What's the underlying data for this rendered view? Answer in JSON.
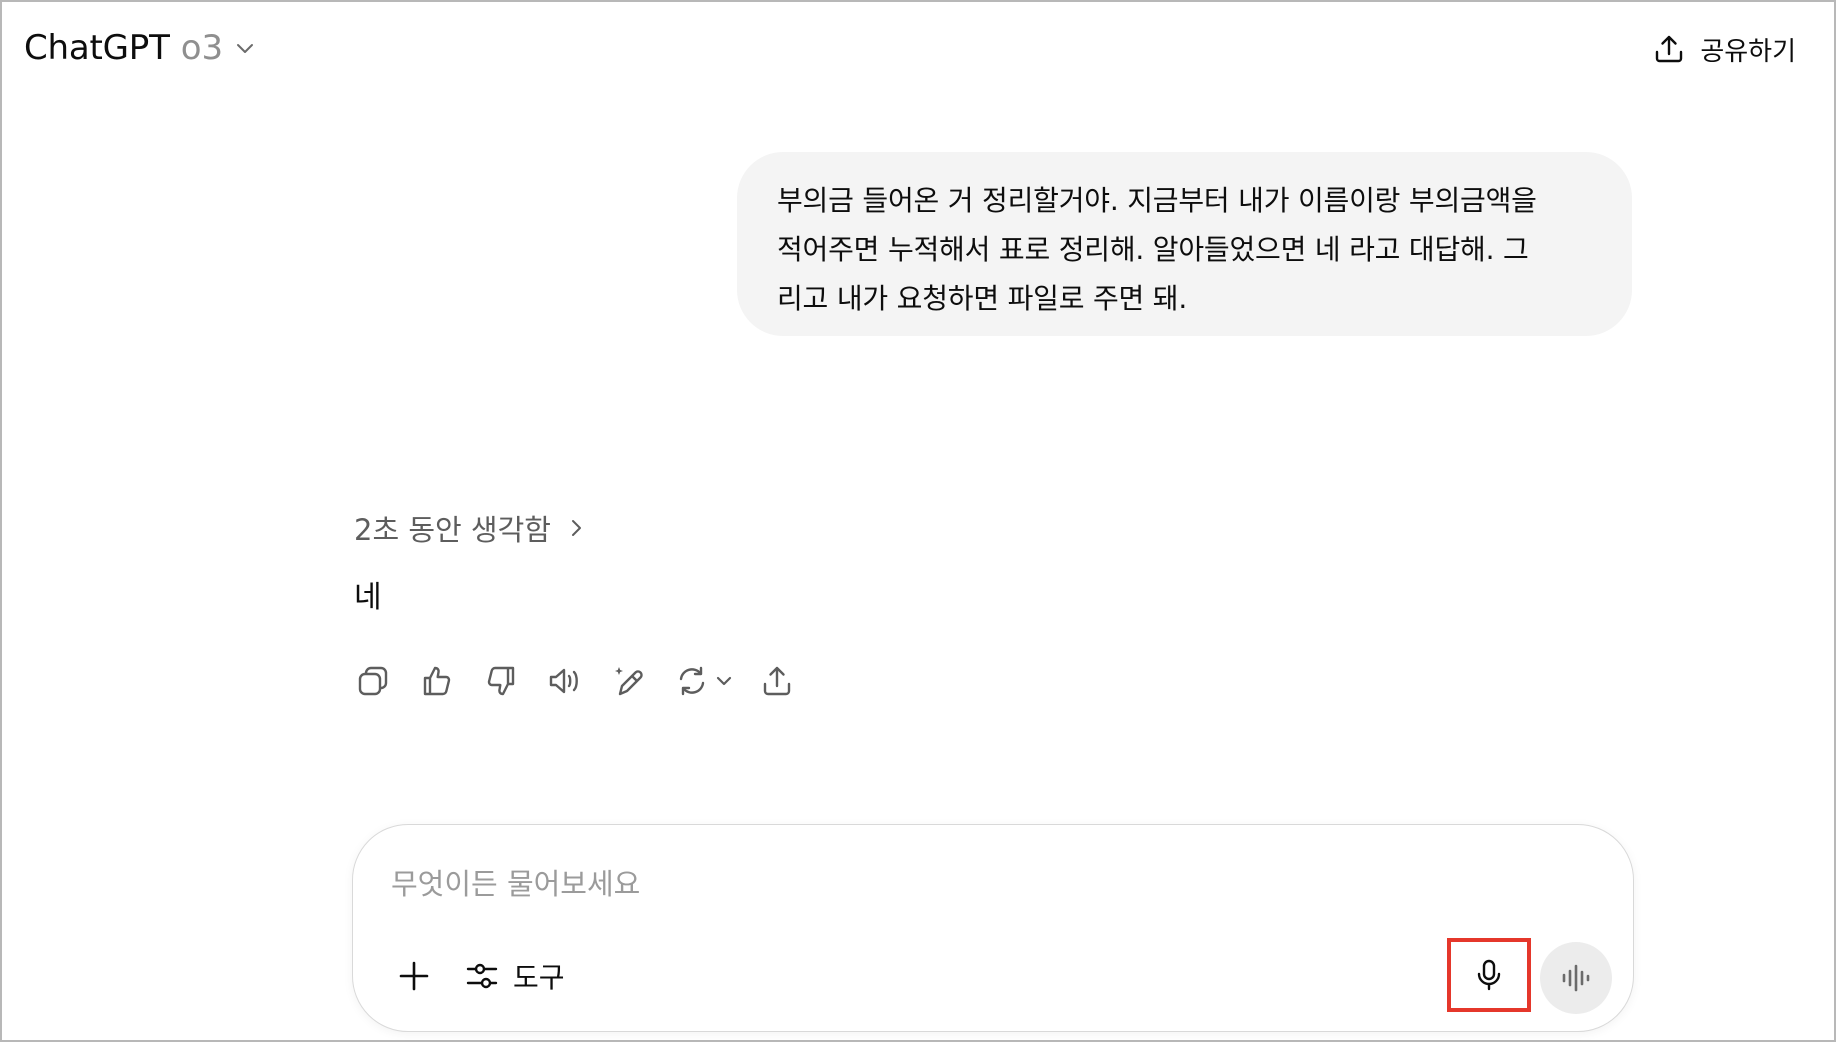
{
  "header": {
    "brand": "ChatGPT",
    "model": "o3",
    "share_label": "공유하기"
  },
  "conversation": {
    "user_message_lines": [
      "부의금 들어온 거 정리할거야. 지금부터 내가 이름이랑 부의금액을",
      "적어주면 누적해서 표로 정리해. 알아들었으면 네 라고 대답해. 그",
      "리고 내가 요청하면 파일로 주면 돼."
    ],
    "thought_label": "2초 동안 생각함",
    "assistant_reply": "네",
    "action_icons": [
      "copy-icon",
      "thumbs-up-icon",
      "thumbs-down-icon",
      "read-aloud-icon",
      "edit-canvas-icon",
      "regenerate-icon",
      "share-icon"
    ]
  },
  "composer": {
    "placeholder": "무엇이든 물어보세요",
    "value": "",
    "tools_label": "도구"
  },
  "colors": {
    "highlight_box": "#e5372b",
    "bubble_bg": "#f4f4f4",
    "muted_text": "#8f8f8f"
  }
}
